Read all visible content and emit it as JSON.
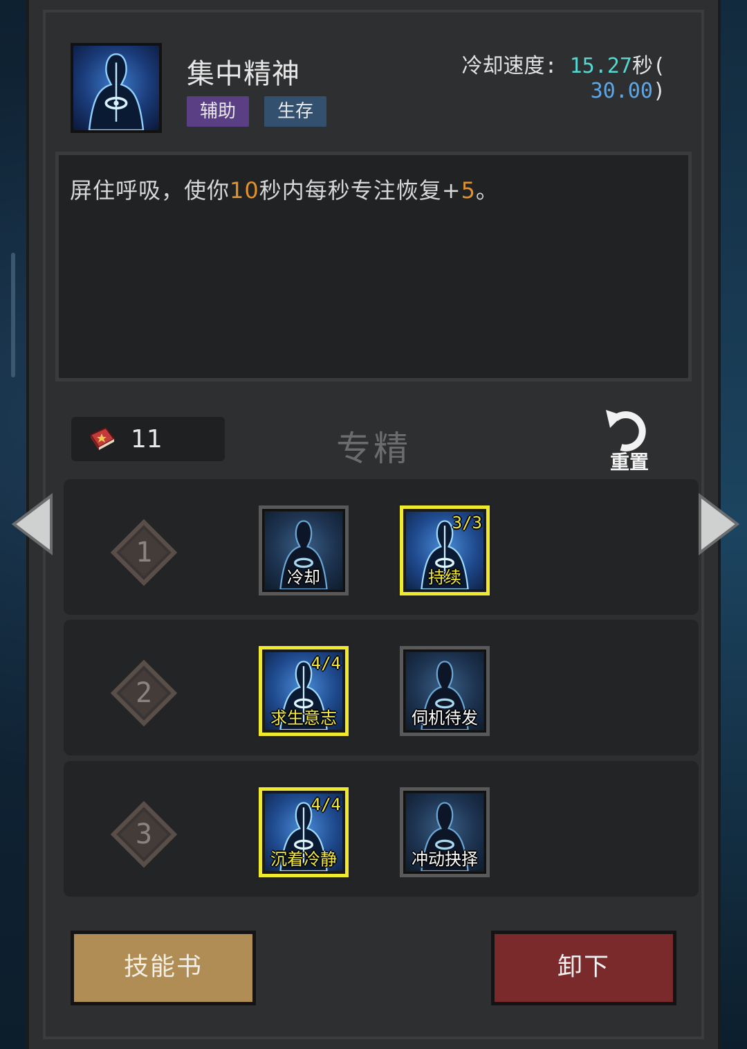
{
  "skill": {
    "name": "集中精神",
    "tags": [
      "辅助",
      "生存"
    ],
    "cooldown_label": "冷却速度:",
    "cooldown_value": "15.27",
    "cooldown_unit": "秒(",
    "cooldown_base": "30.00",
    "cooldown_close": ")"
  },
  "description": {
    "part1": "屏住呼吸，使你",
    "num1": "10",
    "part2": "秒内每秒专注恢复+",
    "num2": "5",
    "part3": "。"
  },
  "spec": {
    "points": "11",
    "title": "专精",
    "reset_label": "重置"
  },
  "tiers": [
    {
      "number": "1",
      "talents": [
        {
          "name": "冷却",
          "rank": "",
          "active": false
        },
        {
          "name": "持续",
          "rank": "3/3",
          "active": true
        }
      ]
    },
    {
      "number": "2",
      "talents": [
        {
          "name": "求生意志",
          "rank": "4/4",
          "active": true
        },
        {
          "name": "伺机待发",
          "rank": "",
          "active": false
        }
      ]
    },
    {
      "number": "3",
      "talents": [
        {
          "name": "沉着冷静",
          "rank": "4/4",
          "active": true
        },
        {
          "name": "冲动抉择",
          "rank": "",
          "active": false
        }
      ]
    }
  ],
  "buttons": {
    "skill_book": "技能书",
    "unequip": "卸下"
  },
  "colors": {
    "highlight": "#e0922e",
    "cooldown_value": "#57d7d1",
    "cooldown_base": "#5ea6e6",
    "tag_support": "#5a3f85",
    "tag_survival": "#33506f",
    "active_border": "#f0ea2e",
    "skill_book_button": "#b08d55",
    "unequip_button": "#7a2a2a"
  }
}
